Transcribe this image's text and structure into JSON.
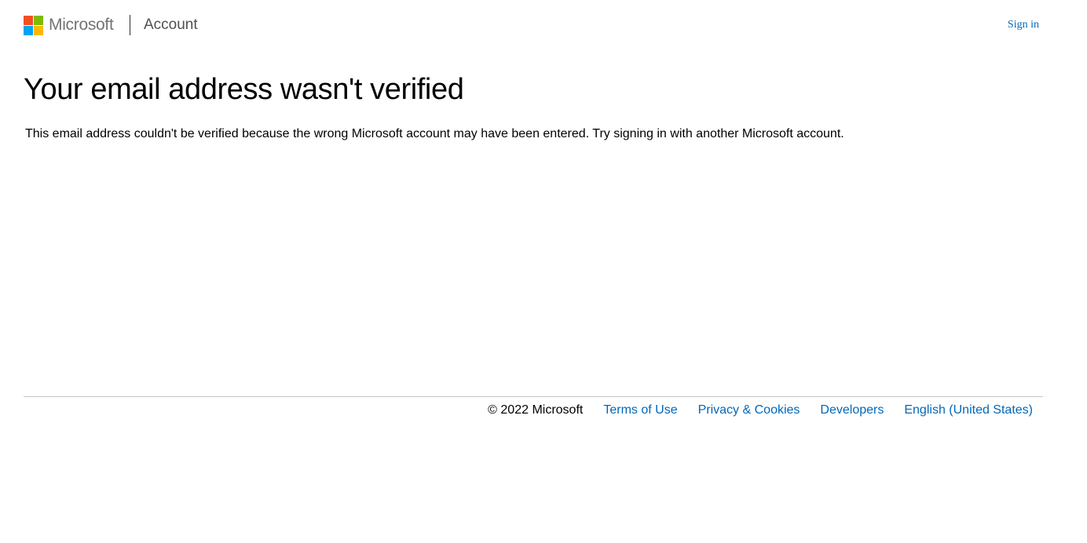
{
  "header": {
    "brand": "Microsoft",
    "product": "Account",
    "sign_in": "Sign in",
    "logo_colors": [
      "#f25022",
      "#7fba00",
      "#00a4ef",
      "#ffb900"
    ]
  },
  "main": {
    "title": "Your email address wasn't verified",
    "description": "This email address couldn't be verified because the wrong Microsoft account may have been entered. Try signing in with another Microsoft account."
  },
  "footer": {
    "copyright": "© 2022 Microsoft",
    "links": [
      "Terms of Use",
      "Privacy & Cookies",
      "Developers",
      "English (United States)"
    ]
  },
  "colors": {
    "link": "#0067b8",
    "brand_text": "#737373",
    "divider": "#c8c8c8"
  }
}
